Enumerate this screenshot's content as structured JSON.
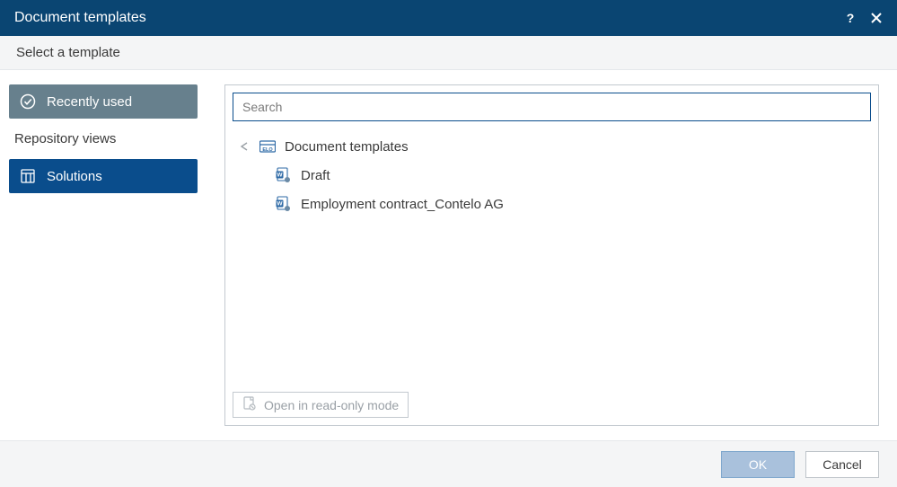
{
  "titlebar": {
    "title": "Document templates"
  },
  "subheader": {
    "prompt": "Select a template"
  },
  "sidebar": {
    "recently_used": "Recently used",
    "section_label": "Repository views",
    "solutions": "Solutions"
  },
  "search": {
    "placeholder": "Search",
    "value": ""
  },
  "tree": {
    "root_label": "Document templates",
    "items": [
      {
        "label": "Draft"
      },
      {
        "label": "Employment contract_Contelo AG"
      }
    ]
  },
  "readonly": {
    "label": "Open in read-only mode"
  },
  "footer": {
    "ok": "OK",
    "cancel": "Cancel"
  }
}
